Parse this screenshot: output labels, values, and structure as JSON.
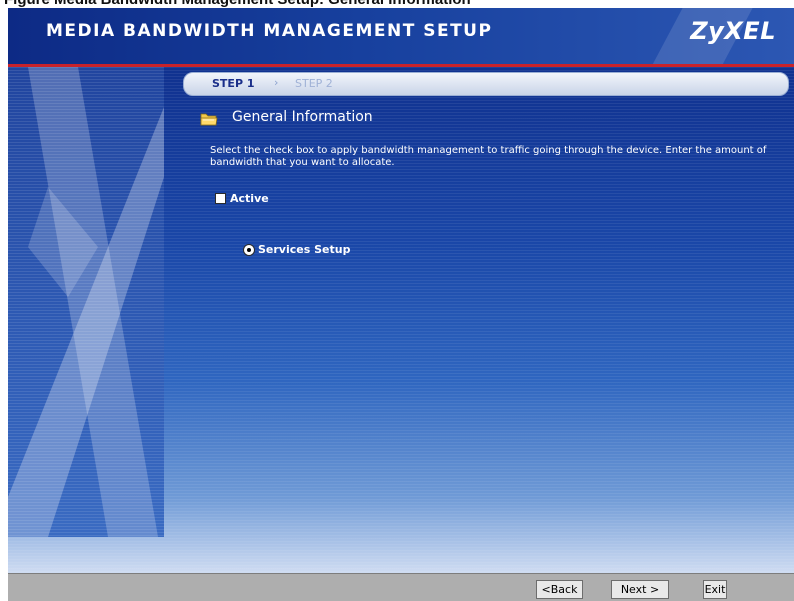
{
  "caption": "Figure Media Bandwidth Management Setup: General Information",
  "header": {
    "title": "MEDIA BANDWIDTH MANAGEMENT SETUP",
    "logo": "ZyXEL"
  },
  "steps": {
    "step1": "STEP 1",
    "arrow": "›",
    "step2": "STEP 2"
  },
  "section": {
    "icon": "folder-icon",
    "title": "General Information",
    "description": "Select the check box to apply bandwidth management to traffic going through the device. Enter the amount of bandwidth that you want to allocate."
  },
  "form": {
    "active_label": "Active",
    "active_checked": false,
    "services_setup_label": "Services Setup",
    "services_setup_selected": true
  },
  "footer": {
    "back": "<Back",
    "next": "Next >",
    "exit": "Exit"
  },
  "colors": {
    "header_blue": "#0d2a85",
    "accent_red": "#c8222b",
    "body_blue": "#1a47a8",
    "footer_gray": "#aeaeae"
  }
}
